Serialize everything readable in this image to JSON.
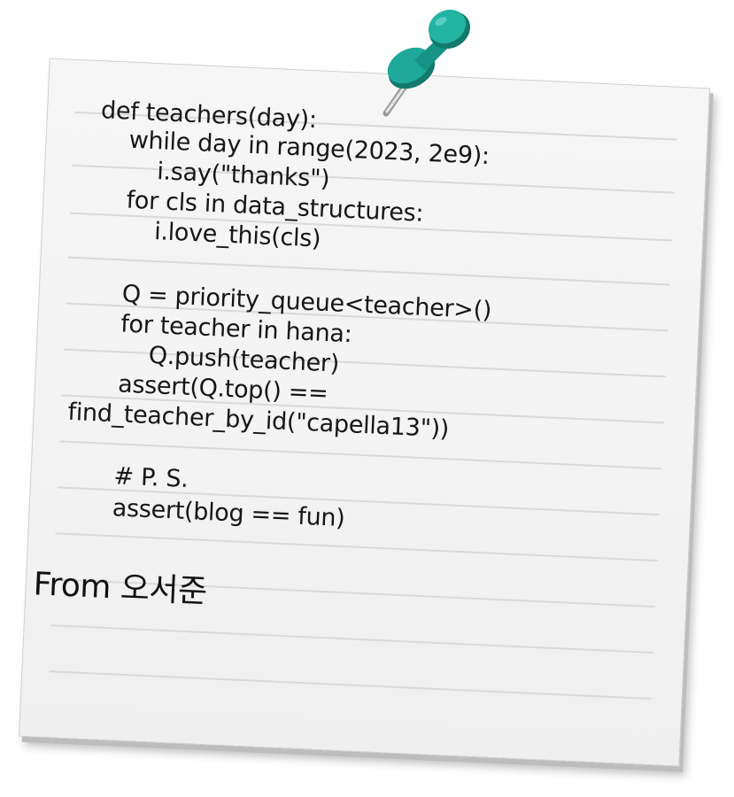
{
  "note": {
    "code_lines": [
      "def teachers(day):",
      "    while day in range(2023, 2e9):",
      "        i.say(\"thanks\")",
      "    for cls in data_structures:",
      "        i.love_this(cls)",
      "",
      "    Q = priority_queue<teacher>()",
      "    for teacher in hana:",
      "        Q.push(teacher)",
      "    assert(Q.top() ==",
      "find_teacher_by_id(\"capella13\"))",
      "",
      "    # P. S.",
      "    assert(blog == fun)"
    ],
    "signature": "From 오서준"
  },
  "colors": {
    "paper": "#f4f4f4",
    "rule": "#d9d9d9",
    "ink": "#161616",
    "pin_head": "#1fa99a",
    "pin_shadow": "#137a6e"
  },
  "icons": {
    "pin": "pushpin-icon"
  }
}
